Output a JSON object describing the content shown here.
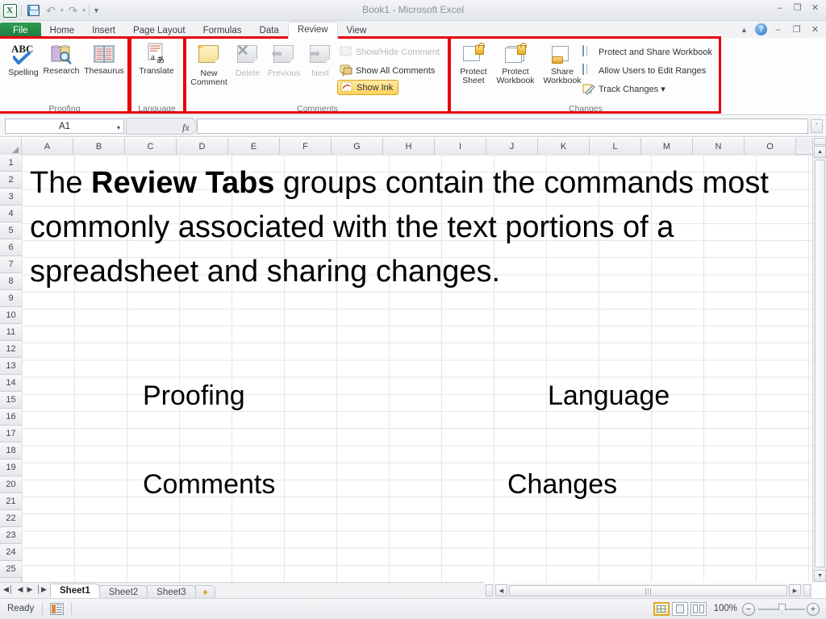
{
  "window": {
    "title": "Book1  -  Microsoft Excel",
    "qat": [
      {
        "name": "excel-logo",
        "label": "X"
      },
      {
        "name": "save-button",
        "label": "save"
      },
      {
        "name": "undo-button",
        "label": "undo"
      },
      {
        "name": "redo-button",
        "label": "redo"
      },
      {
        "name": "customize-qat-button",
        "label": "customize"
      }
    ],
    "controls": {
      "minimize": "–",
      "restore": "❐",
      "close": "✕",
      "doc_minimize": "–",
      "doc_restore": "❐",
      "doc_close": "✕",
      "collapse_ribbon": "▲",
      "help": "?"
    }
  },
  "tabs": [
    {
      "label": "File",
      "active": false,
      "file": true
    },
    {
      "label": "Home",
      "active": false
    },
    {
      "label": "Insert",
      "active": false
    },
    {
      "label": "Page Layout",
      "active": false
    },
    {
      "label": "Formulas",
      "active": false
    },
    {
      "label": "Data",
      "active": false
    },
    {
      "label": "Review",
      "active": true
    },
    {
      "label": "View",
      "active": false
    }
  ],
  "ribbon": {
    "groups": [
      {
        "name": "proofing",
        "label": "Proofing",
        "highlighted": true,
        "buttons": [
          {
            "label": "Spelling",
            "icon": "abc-check-icon",
            "enabled": true
          },
          {
            "label": "Research",
            "icon": "book-magnifier-icon",
            "enabled": true
          },
          {
            "label": "Thesaurus",
            "icon": "open-book-icon",
            "enabled": true
          }
        ]
      },
      {
        "name": "language",
        "label": "Language",
        "highlighted": true,
        "buttons": [
          {
            "label": "Translate",
            "icon": "translate-icon",
            "enabled": true
          }
        ]
      },
      {
        "name": "comments",
        "label": "Comments",
        "highlighted": true,
        "buttons": [
          {
            "label": "New\nComment",
            "line1": "New",
            "line2": "Comment",
            "icon": "new-comment-icon",
            "enabled": true
          },
          {
            "label": "Delete",
            "icon": "delete-comment-icon",
            "enabled": false
          },
          {
            "label": "Previous",
            "icon": "previous-comment-icon",
            "enabled": false
          },
          {
            "label": "Next",
            "icon": "next-comment-icon",
            "enabled": false
          }
        ],
        "small_items": [
          {
            "label": "Show/Hide Comment",
            "icon": "show-hide-comment-icon",
            "enabled": false,
            "active": false
          },
          {
            "label": "Show All Comments",
            "icon": "show-all-comments-icon",
            "enabled": true,
            "active": false
          },
          {
            "label": "Show Ink",
            "icon": "show-ink-icon",
            "enabled": true,
            "active": true
          }
        ]
      },
      {
        "name": "changes",
        "label": "Changes",
        "highlighted": true,
        "buttons": [
          {
            "label": "Protect\nSheet",
            "line1": "Protect",
            "line2": "Sheet",
            "icon": "protect-sheet-icon",
            "enabled": true
          },
          {
            "label": "Protect\nWorkbook",
            "line1": "Protect",
            "line2": "Workbook",
            "icon": "protect-workbook-icon",
            "enabled": true
          },
          {
            "label": "Share\nWorkbook",
            "line1": "Share",
            "line2": "Workbook",
            "icon": "share-workbook-icon",
            "enabled": true
          }
        ],
        "small_items": [
          {
            "label": "Protect and Share Workbook",
            "icon": "protect-share-workbook-icon",
            "enabled": true
          },
          {
            "label": "Allow Users to Edit Ranges",
            "icon": "allow-users-edit-ranges-icon",
            "enabled": true
          },
          {
            "label": "Track Changes ▾",
            "icon": "track-changes-icon",
            "enabled": true
          }
        ]
      }
    ]
  },
  "formula_bar": {
    "name_box_value": "A1",
    "formula_value": "",
    "fx_label": "fx",
    "dropdown_caret": "▾",
    "expand_caret": "ˇ"
  },
  "sheet": {
    "columns": [
      "A",
      "B",
      "C",
      "D",
      "E",
      "F",
      "G",
      "H",
      "I",
      "J",
      "K",
      "L",
      "M",
      "N",
      "O"
    ],
    "rows": [
      1,
      2,
      3,
      4,
      5,
      6,
      7,
      8,
      9,
      10,
      11,
      12,
      13,
      14,
      15,
      16,
      17,
      18,
      19,
      20,
      21,
      22,
      23,
      24,
      25
    ],
    "slide": {
      "body_pre": "The ",
      "body_bold": "Review Tabs",
      "body_post": " groups contain the commands most commonly associated with the text portions of a spreadsheet and sharing changes.",
      "group_labels": [
        {
          "text": "Proofing",
          "col": "left",
          "row": "top"
        },
        {
          "text": "Language",
          "col": "right",
          "row": "top"
        },
        {
          "text": "Comments",
          "col": "left",
          "row": "bottom"
        },
        {
          "text": "Changes",
          "col": "right",
          "row": "bottom"
        }
      ]
    }
  },
  "sheet_tabs": {
    "nav": [
      "◀│",
      "◀",
      "▶",
      "│▶"
    ],
    "items": [
      {
        "label": "Sheet1",
        "active": true
      },
      {
        "label": "Sheet2",
        "active": false
      },
      {
        "label": "Sheet3",
        "active": false
      }
    ],
    "insert_sheet_label": "✦"
  },
  "status_bar": {
    "mode": "Ready",
    "macro_icon": "record-macro-icon",
    "views": [
      {
        "name": "normal-view-button",
        "selected": true
      },
      {
        "name": "page-layout-view-button",
        "selected": false
      },
      {
        "name": "page-break-preview-button",
        "selected": false
      }
    ],
    "zoom_level": "100%",
    "zoom_out": "−",
    "zoom_in": "+"
  },
  "colors": {
    "annotation_red": "#e8000b",
    "file_tab_green": "#1d7a3c",
    "active_highlight": "#ffd25c"
  }
}
